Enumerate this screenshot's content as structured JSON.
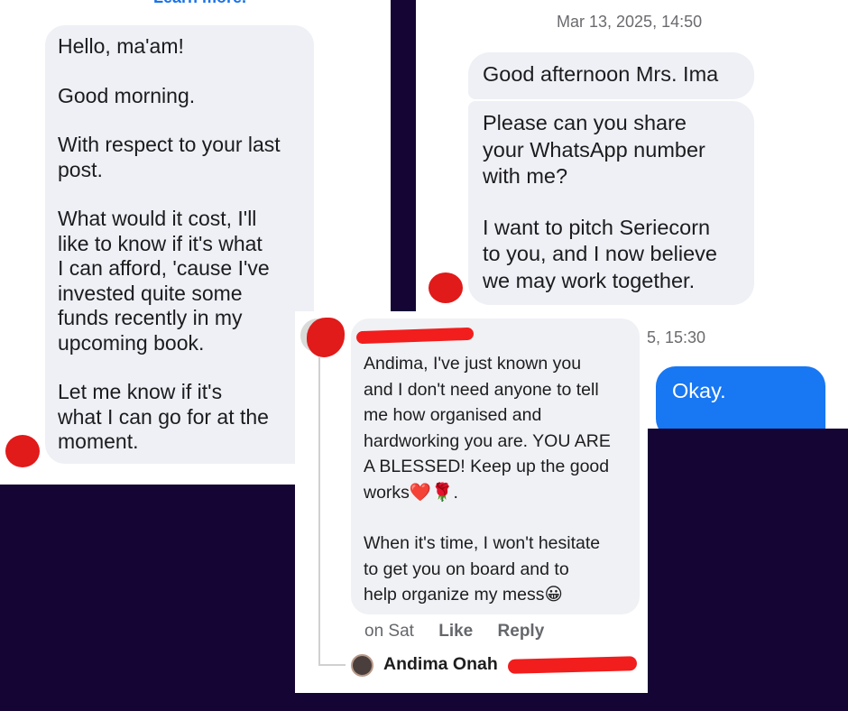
{
  "left_chat": {
    "top_link": "Learn more.",
    "message_paragraphs": [
      "Hello, ma'am!",
      "Good morning.",
      "With respect to your last\npost.",
      "What would it cost, I'll\nlike to know if it's what\nI can afford, 'cause I've\ninvested quite some\nfunds recently in my\nupcoming book.",
      "Let me know if it's\nwhat I can go for at the\nmoment."
    ]
  },
  "right_chat": {
    "timestamp": "Mar 13, 2025, 14:50",
    "message_1": "Good afternoon Mrs. Ima",
    "message_2_paragraphs": [
      "Please can you share\nyour WhatsApp number\nwith me?",
      "I want to pitch Seriecorn\nto you, and I now believe\nwe may work together."
    ],
    "partial_timestamp": "5, 15:30",
    "reply_message": "Okay.",
    "colors": {
      "sent_bubble": "#1877f2",
      "received_bubble": "#eef0f5"
    }
  },
  "comment": {
    "paragraph_1_lines": [
      "Andima, I've just known you",
      "and I don't need anyone to tell",
      "me how organised and",
      "hardworking you are. YOU ARE",
      "A BLESSED!  Keep up the good"
    ],
    "paragraph_1_last_word": "works",
    "paragraph_1_end": ".",
    "paragraph_2_lines": [
      "When it's time, I won't hesitate",
      "to get you on board and to"
    ],
    "paragraph_2_last": "help organize my mess",
    "emoji_heart": "❤️",
    "emoji_rose": "🌹",
    "emoji_smile": "😀",
    "time": "on Sat",
    "like_label": "Like",
    "reply_label": "Reply",
    "reply_author": "Andima Onah"
  },
  "background_color": "#140534"
}
